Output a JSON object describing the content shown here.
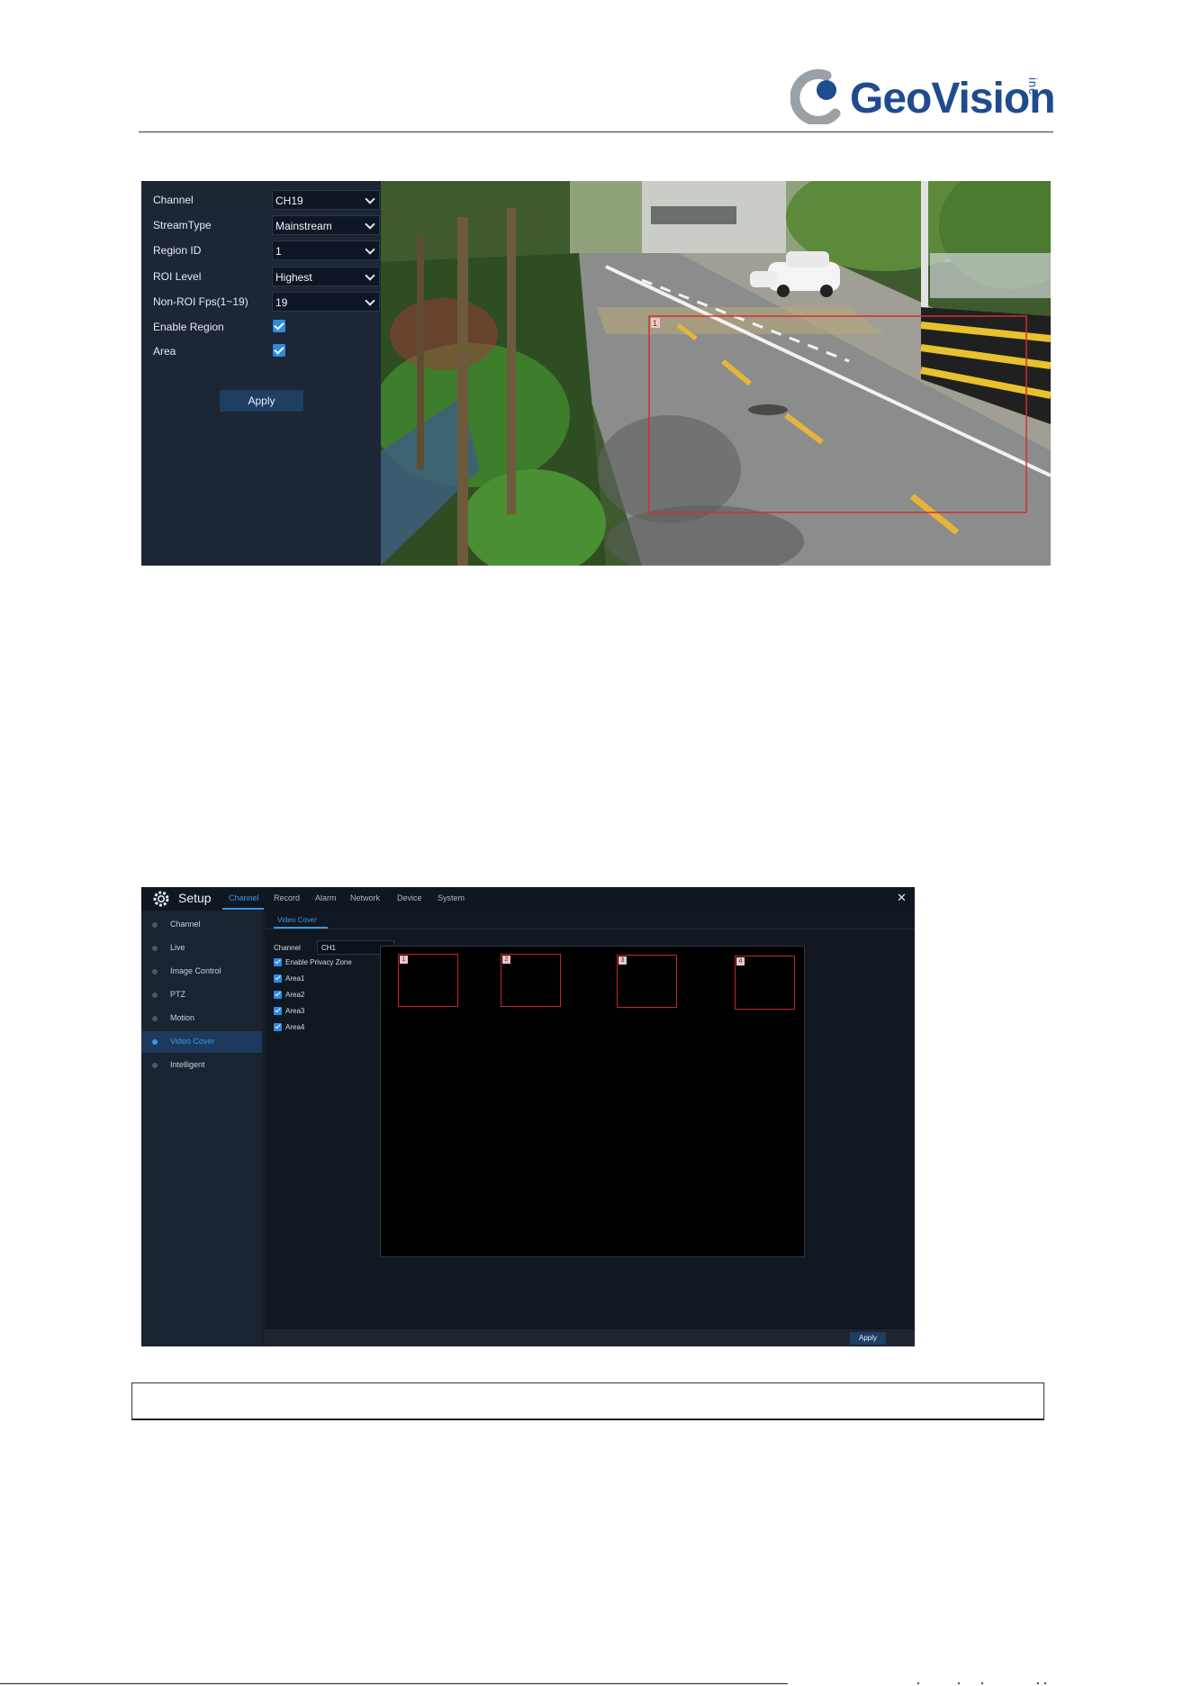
{
  "header": {
    "brand": "GeoVision",
    "brand_suffix": "inc"
  },
  "roi_screen": {
    "fields": [
      {
        "label": "Channel",
        "type": "select",
        "value": "CH19"
      },
      {
        "label": "StreamType",
        "type": "select",
        "value": "Mainstream"
      },
      {
        "label": "Region ID",
        "type": "select",
        "value": "1"
      },
      {
        "label": "ROI Level",
        "type": "select",
        "value": "Highest"
      },
      {
        "label": "Non-ROI Fps(1~19)",
        "type": "select",
        "value": "19"
      },
      {
        "label": "Enable Region",
        "type": "checkbox",
        "checked": true
      },
      {
        "label": "Area",
        "type": "checkbox",
        "checked": true
      }
    ],
    "apply_label": "Apply",
    "region_number": "1",
    "region_color": "#d0302f"
  },
  "video_cover_screen": {
    "title": "Setup",
    "top_tabs": [
      "Channel",
      "Record",
      "Alarm",
      "Network",
      "Device",
      "System"
    ],
    "active_top_tab": "Channel",
    "sidebar": [
      "Channel",
      "Live",
      "Image Control",
      "PTZ",
      "Motion",
      "Video Cover",
      "Intelligent"
    ],
    "active_sidebar_item": "Video Cover",
    "sub_tab": "Video Cover",
    "channel_label": "Channel",
    "channel_value": "CH1",
    "checkboxes": [
      {
        "label": "Enable Privacy Zone",
        "checked": true
      },
      {
        "label": "Area1",
        "checked": true
      },
      {
        "label": "Area2",
        "checked": true
      },
      {
        "label": "Area3",
        "checked": true
      },
      {
        "label": "Area4",
        "checked": true
      }
    ],
    "area_labels": [
      "1",
      "2",
      "3",
      "4"
    ],
    "apply_label": "Apply",
    "accent_color": "#3a96e8",
    "area_color": "#c0282b"
  },
  "colors": {
    "brand_blue": "#1f4b8f",
    "panel_bg": "#1c2634",
    "checkbox_blue": "#2e8be0"
  }
}
